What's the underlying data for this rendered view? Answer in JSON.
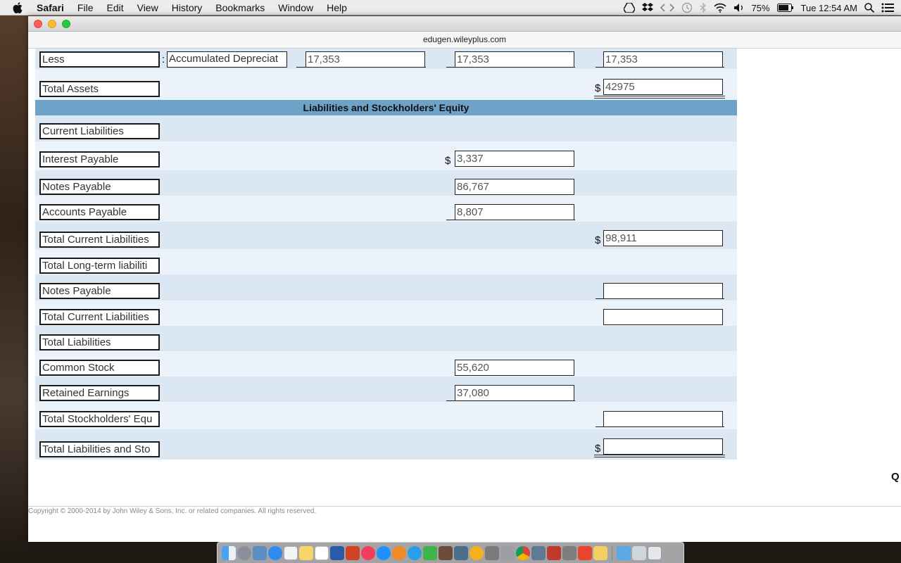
{
  "menubar": {
    "app_name": "Safari",
    "items": [
      "File",
      "Edit",
      "View",
      "History",
      "Bookmarks",
      "Window",
      "Help"
    ],
    "battery": "75%",
    "clock": "Tue 12:54 AM"
  },
  "browser": {
    "url": "edugen.wileyplus.com"
  },
  "balance_sheet": {
    "less_row": {
      "label": "Less",
      "colon": ":",
      "sub_label": "Accumulated Depreciat",
      "val1": "17,353",
      "val2": "17,353",
      "val3": "17,353"
    },
    "total_assets": {
      "label": "Total Assets",
      "dollar": "$",
      "value": "42975"
    },
    "section_title": "Liabilities and Stockholders' Equity",
    "rows": [
      {
        "label": "Current Liabilities"
      },
      {
        "label": "Interest Payable",
        "dollar": "$",
        "value": "3,337"
      },
      {
        "label": "Notes Payable",
        "value": "86,767"
      },
      {
        "label": "Accounts Payable",
        "value": "8,807"
      },
      {
        "label": "Total Current Liabilities",
        "dollar": "$",
        "value": "98,911"
      },
      {
        "label": "Total Long-term liabiliti"
      },
      {
        "label": "Notes Payable",
        "value": ""
      },
      {
        "label": "Total Current Liabilities",
        "value": ""
      },
      {
        "label": "Total Liabilities"
      },
      {
        "label": "Common Stock",
        "value": "55,620"
      },
      {
        "label": "Retained Earnings",
        "value": "37,080"
      },
      {
        "label": "Total Stockholders' Equ",
        "value": ""
      },
      {
        "label": "Total Liabilities and Sto",
        "dollar": "$",
        "value": ""
      }
    ]
  },
  "side_letter": "Q",
  "footer": "Copyright © 2000-2014 by John Wiley & Sons, Inc. or related companies. All rights reserved."
}
